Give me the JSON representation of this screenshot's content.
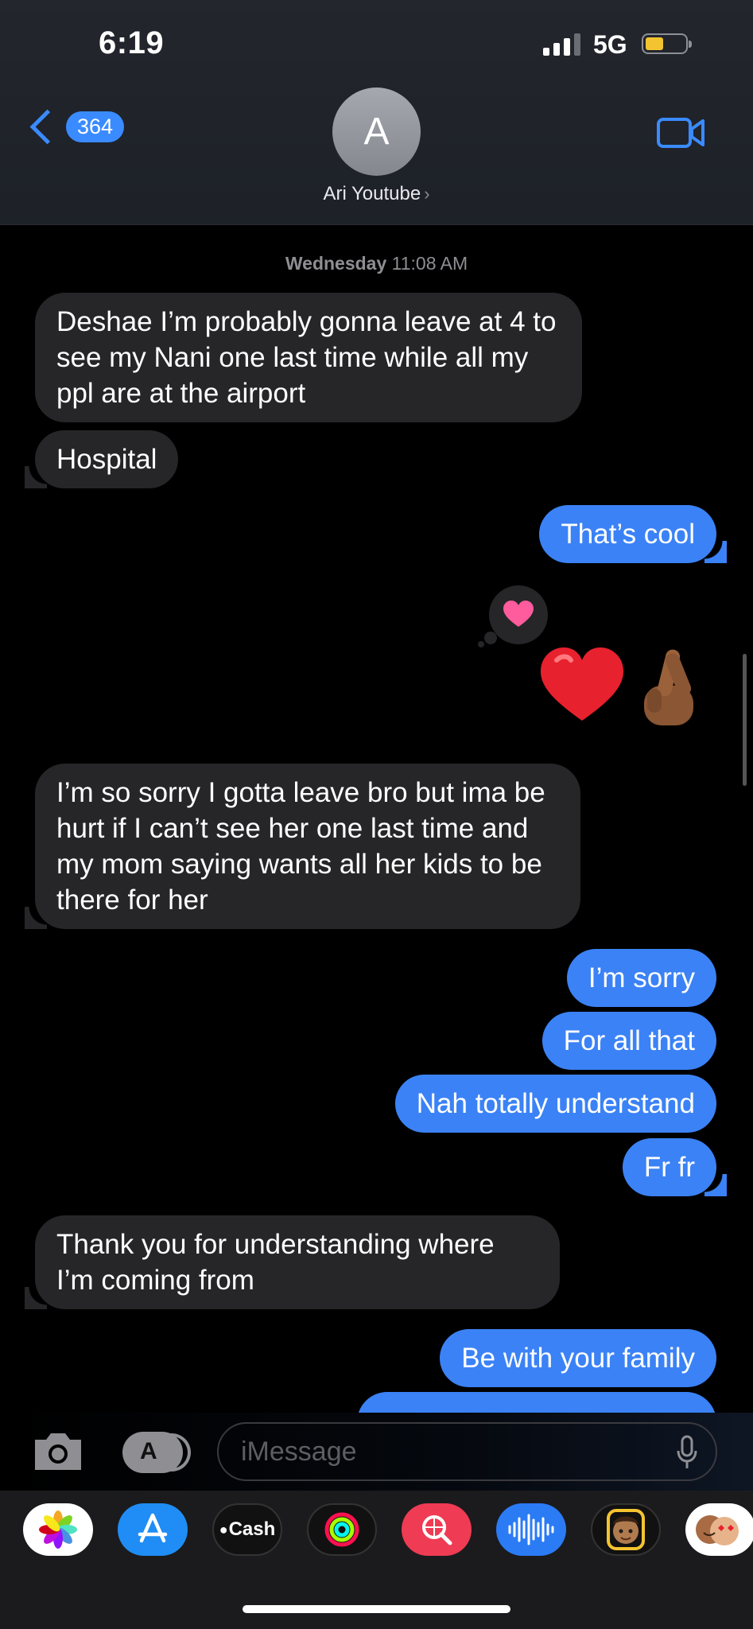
{
  "status_bar": {
    "time": "6:19",
    "network": "5G",
    "signal_bars": 4,
    "signal_active": 3,
    "battery_level": 0.4,
    "battery_color": "#f4c430"
  },
  "header": {
    "back_count": "364",
    "avatar_initial": "A",
    "contact_name": "Ari Youtube",
    "contact_chevron": "›",
    "video_icon": "video-camera-icon",
    "accent_color": "#3a8bff"
  },
  "conversation": {
    "timestamp_day": "Wednesday",
    "timestamp_time": "11:08 AM",
    "messages": [
      {
        "dir": "in",
        "text": "Deshae I’m probably gonna leave at 4 to see my Nani one last time while all my ppl are at the airport"
      },
      {
        "dir": "in",
        "text": "Hospital"
      },
      {
        "dir": "out",
        "text": "That’s cool"
      },
      {
        "dir": "in",
        "text": "I’m so sorry I gotta leave bro but ima be hurt if I can’t see her one last time and my mom saying wants all her kids to be there for her"
      },
      {
        "dir": "out",
        "text": "I’m sorry"
      },
      {
        "dir": "out",
        "text": "For all that"
      },
      {
        "dir": "out",
        "text": "Nah totally understand"
      },
      {
        "dir": "out",
        "text": "Fr fr"
      },
      {
        "dir": "in",
        "text": "Thank you for understanding where I’m coming from"
      },
      {
        "dir": "out",
        "text": "Be with your family"
      }
    ],
    "tapback": "heart-tapback-icon",
    "emojis": [
      "red-heart-emoji",
      "crossed-fingers-emoji"
    ],
    "incoming_color": "#262628",
    "outgoing_color": "#3b82f6"
  },
  "composer": {
    "placeholder": "iMessage",
    "camera_icon": "camera-icon",
    "apps_icon": "app-store-icon",
    "mic_icon": "microphone-icon"
  },
  "app_drawer": {
    "apps": [
      "photos-icon",
      "app-store-icon",
      "apple-cash-icon",
      "activity-icon",
      "image-search-icon",
      "audio-message-icon",
      "memoji-icon",
      "memoji-stickers-icon"
    ],
    "cash_label": "Cash"
  }
}
